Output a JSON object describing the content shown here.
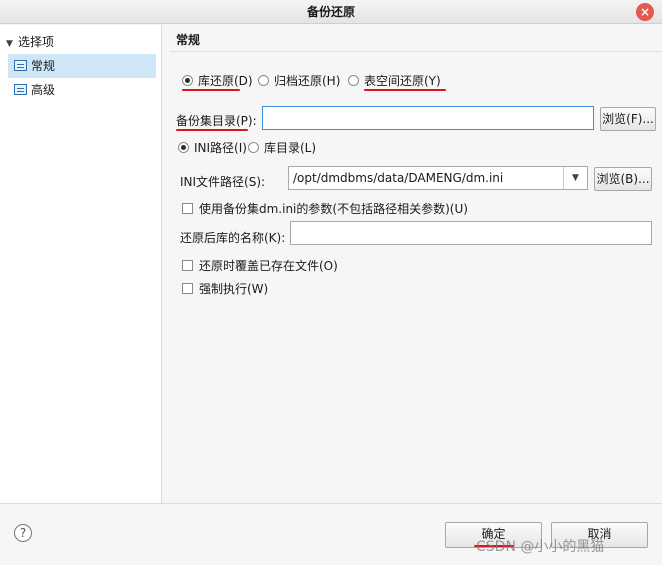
{
  "window": {
    "title": "备份还原",
    "close_glyph": "×"
  },
  "sidebar": {
    "root_label": "选择项",
    "items": [
      {
        "label": "常规",
        "selected": true
      },
      {
        "label": "高级",
        "selected": false
      }
    ]
  },
  "section": {
    "title": "常规"
  },
  "restore_type": {
    "options": [
      {
        "label": "库还原(D)",
        "checked": true
      },
      {
        "label": "归档还原(H)",
        "checked": false
      },
      {
        "label": "表空间还原(Y)",
        "checked": false
      }
    ]
  },
  "backup_dir": {
    "label": "备份集目录(P):",
    "value": "",
    "browse_label": "浏览(F)..."
  },
  "path_type": {
    "options": [
      {
        "label": "INI路径(I)",
        "checked": true
      },
      {
        "label": "库目录(L)",
        "checked": false
      }
    ]
  },
  "ini_path": {
    "label": "INI文件路径(S):",
    "value": "/opt/dmdbms/data/DAMENG/dm.ini",
    "dropdown_glyph": "▼",
    "browse_label": "浏览(B)..."
  },
  "use_backup_ini": {
    "label": "使用备份集dm.ini的参数(不包括路径相关参数)(U)",
    "checked": false
  },
  "restored_name": {
    "label": "还原后库的名称(K):",
    "value": ""
  },
  "overwrite_existing": {
    "label": "还原时覆盖已存在文件(O)",
    "checked": false
  },
  "force_execute": {
    "label": "强制执行(W)",
    "checked": false
  },
  "footer": {
    "help_glyph": "?",
    "ok_label": "确定",
    "cancel_label": "取消"
  },
  "watermark": {
    "text": "CSDN @小小的黑猫"
  },
  "colors": {
    "annotation_red": "#d8141e",
    "selection_blue": "#cfe6f7",
    "focus_blue": "#3b8ed8"
  }
}
